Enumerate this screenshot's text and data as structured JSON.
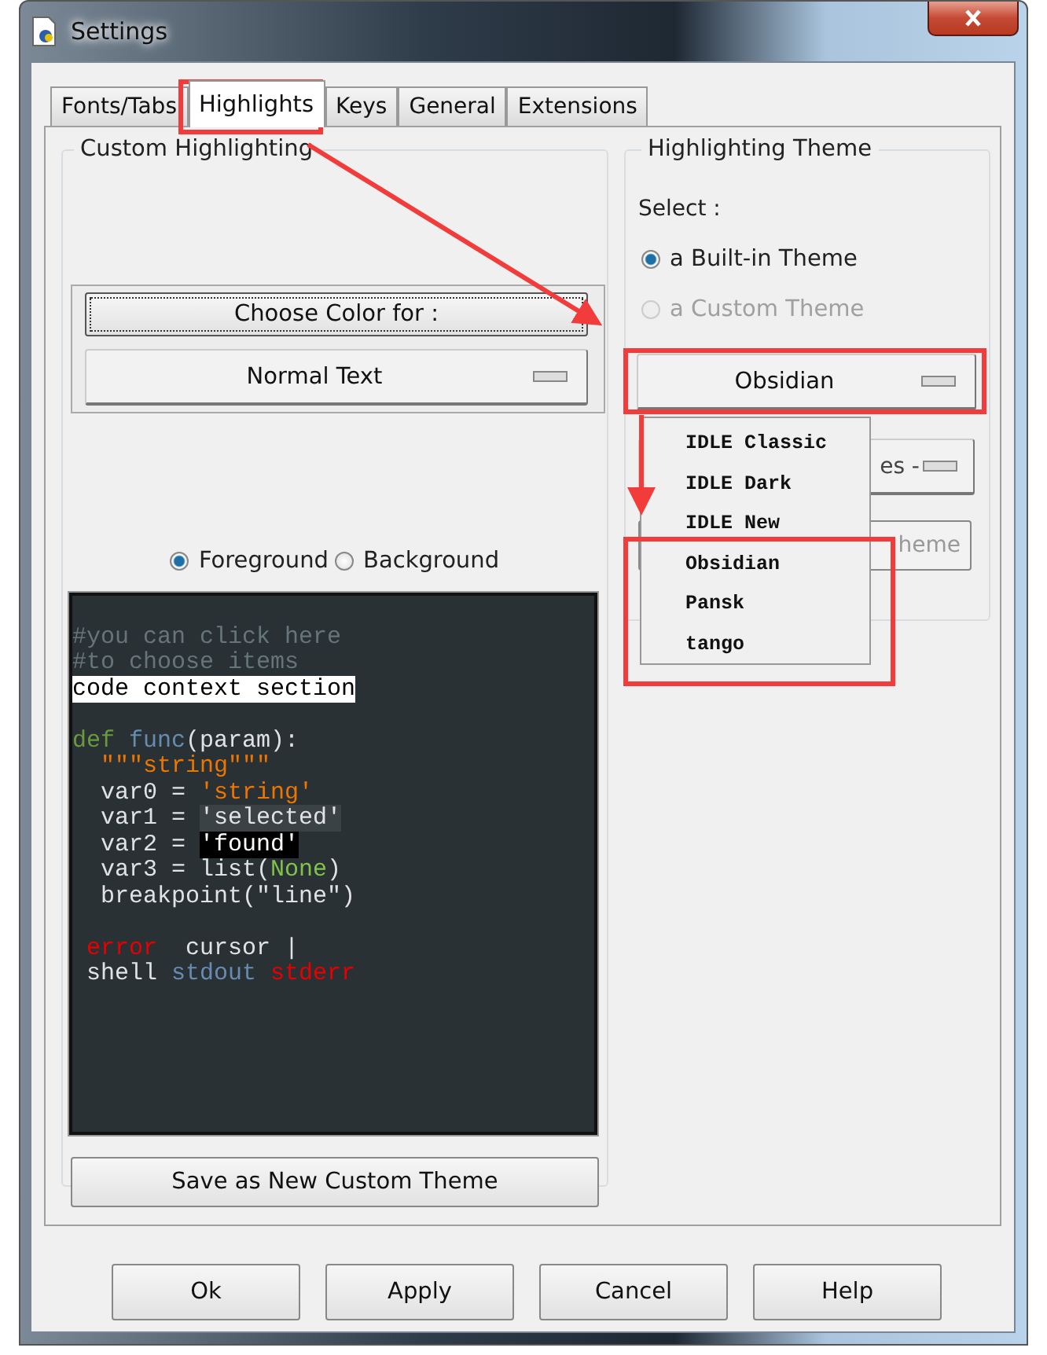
{
  "window": {
    "title": "Settings"
  },
  "tabs": [
    {
      "label": "Fonts/Tabs",
      "selected": false
    },
    {
      "label": "Highlights",
      "selected": true
    },
    {
      "label": "Keys",
      "selected": false
    },
    {
      "label": "General",
      "selected": false
    },
    {
      "label": "Extensions",
      "selected": false
    }
  ],
  "custom_highlighting": {
    "title": "Custom Highlighting",
    "choose_color_button": "Choose Color for :",
    "element_dropdown": "Normal Text",
    "target_radios": [
      {
        "label": "Foreground",
        "selected": true
      },
      {
        "label": "Background",
        "selected": false
      }
    ],
    "sample_code": [
      {
        "kind": "blank"
      },
      {
        "kind": "code",
        "segments": [
          {
            "kind": "comment",
            "text": "#you can click here"
          }
        ]
      },
      {
        "kind": "code",
        "segments": [
          {
            "kind": "comment",
            "text": "#to choose items"
          }
        ]
      },
      {
        "kind": "code",
        "segments": [
          {
            "kind": "context",
            "text": "code context section"
          }
        ]
      },
      {
        "kind": "blank"
      },
      {
        "kind": "code",
        "segments": [
          {
            "kind": "keyword",
            "text": "def "
          },
          {
            "kind": "definition",
            "text": "func"
          },
          {
            "kind": "normal",
            "text": "(param):"
          }
        ]
      },
      {
        "kind": "code",
        "segments": [
          {
            "kind": "string",
            "text": "  \"\"\"string\"\"\""
          }
        ]
      },
      {
        "kind": "code",
        "segments": [
          {
            "kind": "normal",
            "text": "  var0 = "
          },
          {
            "kind": "string",
            "text": "'string'"
          }
        ]
      },
      {
        "kind": "code",
        "segments": [
          {
            "kind": "normal",
            "text": "  var1 = "
          },
          {
            "kind": "selected",
            "text": "'selected'"
          }
        ]
      },
      {
        "kind": "code",
        "segments": [
          {
            "kind": "normal",
            "text": "  var2 = "
          },
          {
            "kind": "found",
            "text": "'found'"
          }
        ]
      },
      {
        "kind": "code",
        "segments": [
          {
            "kind": "normal",
            "text": "  var3 = list("
          },
          {
            "kind": "builtin",
            "text": "None"
          },
          {
            "kind": "normal",
            "text": ")"
          }
        ]
      },
      {
        "kind": "code",
        "segments": [
          {
            "kind": "normal",
            "text": "  breakpoint(\"line\")"
          }
        ]
      },
      {
        "kind": "blank"
      },
      {
        "kind": "code",
        "segments": [
          {
            "kind": "error",
            "text": " error"
          },
          {
            "kind": "normal",
            "text": "  cursor |"
          }
        ]
      },
      {
        "kind": "code",
        "segments": [
          {
            "kind": "normal",
            "text": " shell "
          },
          {
            "kind": "stdout",
            "text": "stdout "
          },
          {
            "kind": "stderr",
            "text": "stderr"
          }
        ]
      }
    ],
    "save_button": "Save as New Custom Theme"
  },
  "highlighting_theme": {
    "title": "Highlighting Theme",
    "select_label": "Select :",
    "theme_type_radios": [
      {
        "label": "a Built-in Theme",
        "selected": true,
        "disabled": false
      },
      {
        "label": "a Custom Theme",
        "selected": false,
        "disabled": true
      }
    ],
    "builtin_dropdown": "Obsidian",
    "custom_dropdown_visible_text": "es -",
    "delete_button_visible_text": "heme",
    "dropdown_menu": [
      "IDLE Classic",
      "IDLE Dark",
      "IDLE New",
      "Obsidian",
      "Pansk",
      "tango"
    ]
  },
  "buttons": [
    "Ok",
    "Apply",
    "Cancel",
    "Help"
  ]
}
